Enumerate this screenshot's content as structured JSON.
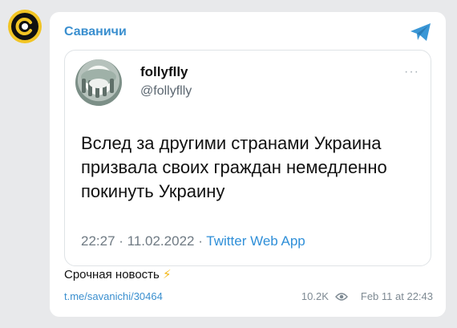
{
  "channel": {
    "name": "Саваничи"
  },
  "tweet": {
    "display_name": "follyflly",
    "handle": "@follyflly",
    "more": "···",
    "text": "Вслед за другими странами Украина призвала своих граждан немедленно покинуть Украину",
    "time": "22:27",
    "date": "11.02.2022",
    "separator": " · ",
    "app": "Twitter Web App"
  },
  "post": {
    "caption": "Срочная новость",
    "caption_emoji": "⚡",
    "link": "t.me/savanichi/30464",
    "views": "10.2K",
    "date": "Feb 11 at 22:43"
  },
  "colors": {
    "accent": "#3a8fcf",
    "avatar_ring": "#f2c524"
  }
}
